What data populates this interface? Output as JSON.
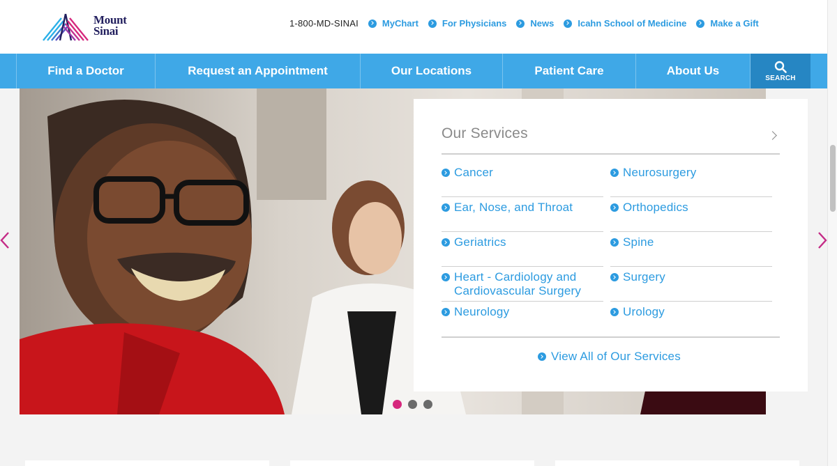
{
  "logo": {
    "line1": "Mount",
    "line2": "Sinai",
    "icon": "mount-sinai-logo-mark"
  },
  "utility": {
    "phone": "1-800-MD-SINAI",
    "links": [
      {
        "label": "MyChart"
      },
      {
        "label": "For Physicians"
      },
      {
        "label": "News"
      },
      {
        "label": "Icahn School of Medicine"
      },
      {
        "label": "Make a Gift"
      }
    ]
  },
  "nav": {
    "items": [
      {
        "label": "Find a Doctor"
      },
      {
        "label": "Request an Appointment"
      },
      {
        "label": "Our Locations"
      },
      {
        "label": "Patient Care"
      },
      {
        "label": "About Us"
      }
    ],
    "search_label": "SEARCH"
  },
  "services": {
    "title": "Our Services",
    "left": [
      {
        "label": "Cancer"
      },
      {
        "label": "Ear, Nose, and Throat"
      },
      {
        "label": "Geriatrics"
      },
      {
        "label": "Heart - Cardiology and Cardiovascular Surgery"
      },
      {
        "label": "Neurology"
      }
    ],
    "right": [
      {
        "label": "Neurosurgery"
      },
      {
        "label": "Orthopedics"
      },
      {
        "label": "Spine"
      },
      {
        "label": "Surgery"
      },
      {
        "label": "Urology"
      }
    ],
    "view_all": "View All of Our Services"
  },
  "carousel": {
    "slide_count": 3,
    "active_slide": 1
  },
  "colors": {
    "accent_blue": "#3fa8e7",
    "link_blue": "#2c9be0",
    "search_blue": "#2686c3",
    "brand_navy": "#221f5e",
    "brand_magenta": "#d6287d",
    "arrow_magenta": "#c42a86"
  }
}
